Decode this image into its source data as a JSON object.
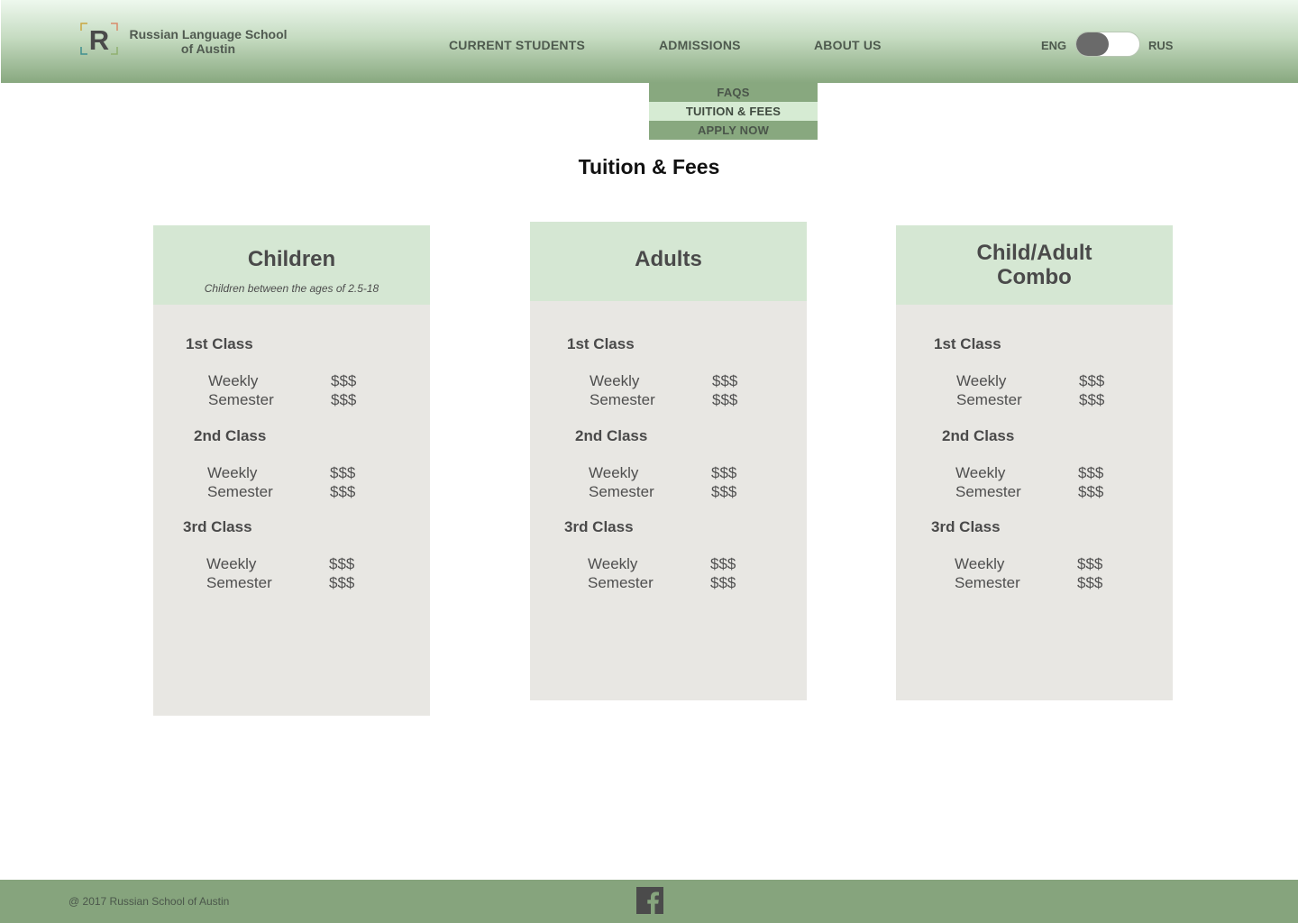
{
  "header": {
    "school_name_line1": "Russian Language School",
    "school_name_line2": "of Austin",
    "logo_letter": "R",
    "nav": {
      "current_students": "CURRENT STUDENTS",
      "admissions": "ADMISSIONS",
      "about_us": "ABOUT US"
    },
    "language": {
      "left": "ENG",
      "right": "RUS",
      "selected": "ENG"
    }
  },
  "dropdown": {
    "items": [
      "FAQS",
      "TUITION & FEES",
      "APPLY NOW"
    ],
    "active": "TUITION & FEES"
  },
  "page": {
    "title": "Tuition & Fees"
  },
  "cards": [
    {
      "title": "Children",
      "subtitle": "Children between the ages of 2.5-18",
      "classes": [
        {
          "name": "1st Class",
          "rows": [
            {
              "label": "Weekly",
              "price": "$$$"
            },
            {
              "label": "Semester",
              "price": "$$$"
            }
          ]
        },
        {
          "name": "2nd Class",
          "rows": [
            {
              "label": "Weekly",
              "price": "$$$"
            },
            {
              "label": "Semester",
              "price": "$$$"
            }
          ]
        },
        {
          "name": "3rd Class",
          "rows": [
            {
              "label": "Weekly",
              "price": "$$$"
            },
            {
              "label": "Semester",
              "price": "$$$"
            }
          ]
        }
      ]
    },
    {
      "title": "Adults",
      "subtitle": "",
      "classes": [
        {
          "name": "1st Class",
          "rows": [
            {
              "label": "Weekly",
              "price": "$$$"
            },
            {
              "label": "Semester",
              "price": "$$$"
            }
          ]
        },
        {
          "name": "2nd Class",
          "rows": [
            {
              "label": "Weekly",
              "price": "$$$"
            },
            {
              "label": "Semester",
              "price": "$$$"
            }
          ]
        },
        {
          "name": "3rd Class",
          "rows": [
            {
              "label": "Weekly",
              "price": "$$$"
            },
            {
              "label": "Semester",
              "price": "$$$"
            }
          ]
        }
      ]
    },
    {
      "title_line1": "Child/Adult",
      "title_line2": "Combo",
      "classes": [
        {
          "name": "1st Class",
          "rows": [
            {
              "label": "Weekly",
              "price": "$$$"
            },
            {
              "label": "Semester",
              "price": "$$$"
            }
          ]
        },
        {
          "name": "2nd Class",
          "rows": [
            {
              "label": "Weekly",
              "price": "$$$"
            },
            {
              "label": "Semester",
              "price": "$$$"
            }
          ]
        },
        {
          "name": "3rd Class",
          "rows": [
            {
              "label": "Weekly",
              "price": "$$$"
            },
            {
              "label": "Semester",
              "price": "$$$"
            }
          ]
        }
      ]
    }
  ],
  "footer": {
    "copyright": "@ 2017 Russian School of Austin",
    "social_icon": "facebook-icon"
  },
  "colors": {
    "header_gradient_top": "#eef8ee",
    "header_gradient_bottom": "#88a87f",
    "card_header": "#d5e7d3",
    "card_body": "#e8e7e3",
    "footer": "#86a47d",
    "dropdown_active": "#d6ebd3"
  }
}
